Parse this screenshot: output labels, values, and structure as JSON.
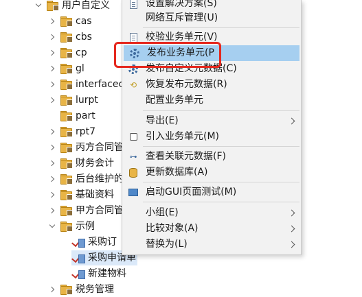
{
  "tree": {
    "root": {
      "label": "用户自定义"
    },
    "items": [
      {
        "label": "cas"
      },
      {
        "label": "cbs"
      },
      {
        "label": "cp"
      },
      {
        "label": "gl"
      },
      {
        "label": "interfacec"
      },
      {
        "label": "lurpt"
      },
      {
        "label": "part"
      },
      {
        "label": "rpt7"
      },
      {
        "label": "丙方合同管"
      },
      {
        "label": "财务会计"
      },
      {
        "label": "后台维护的"
      },
      {
        "label": "基础资料"
      },
      {
        "label": "甲方合同管"
      },
      {
        "label": "示例"
      }
    ],
    "children": [
      {
        "label": "采购订"
      },
      {
        "label": "采购申请单"
      },
      {
        "label": "新建物料"
      }
    ],
    "last": {
      "label": "税务管理"
    }
  },
  "context_menu": {
    "items": [
      {
        "label": "设置解决方案(S)",
        "icon": "solution-icon"
      },
      {
        "label": "网络互斥管理(U)",
        "icon": ""
      },
      {
        "label": "校验业务单元(V)",
        "icon": "validate-icon"
      },
      {
        "label": "发布业务单元(P",
        "icon": "publish-gear-icon"
      },
      {
        "label": "发布自定义元数据(C)",
        "icon": "publish-gear-icon"
      },
      {
        "label": "恢复发布元数据(R)",
        "icon": "restore-icon"
      },
      {
        "label": "配置业务单元",
        "icon": ""
      },
      {
        "label": "导出(E)",
        "icon": ""
      },
      {
        "label": "引入业务单元(M)",
        "icon": "checkbox-icon"
      },
      {
        "label": "查看关联元数据(F)",
        "icon": "relation-icon"
      },
      {
        "label": "更新数据库(A)",
        "icon": "database-icon"
      },
      {
        "label": "启动GUI页面测试(M)",
        "icon": "monitor-icon"
      },
      {
        "label": "小组(E)",
        "icon": ""
      },
      {
        "label": "比较对象(A)",
        "icon": ""
      },
      {
        "label": "替换为(L)",
        "icon": ""
      }
    ]
  },
  "colors": {
    "highlight": "#a6cff0",
    "annotation_red": "#e5281e",
    "folder": "#e8b446"
  }
}
